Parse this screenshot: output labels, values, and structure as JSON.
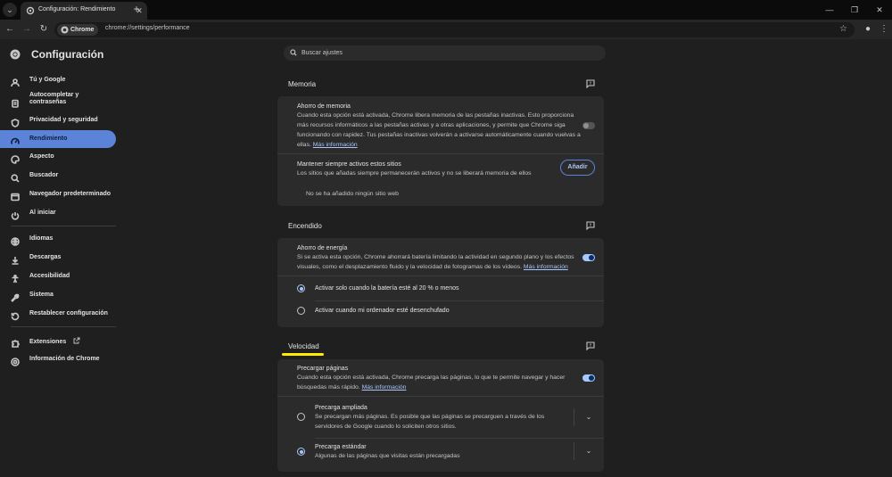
{
  "browser": {
    "tab_title": "Configuración: Rendimiento",
    "site_chip": "Chrome",
    "url": "chrome://settings/performance"
  },
  "sidebar": {
    "title": "Configuración",
    "items": [
      {
        "label": "Tú y Google",
        "icon": "person-icon"
      },
      {
        "label": "Autocompletar y contraseñas",
        "icon": "clipboard-icon"
      },
      {
        "label": "Privacidad y seguridad",
        "icon": "shield-icon"
      },
      {
        "label": "Rendimiento",
        "icon": "speedometer-icon",
        "selected": true
      },
      {
        "label": "Aspecto",
        "icon": "palette-icon"
      },
      {
        "label": "Buscador",
        "icon": "search-icon"
      },
      {
        "label": "Navegador predeterminado",
        "icon": "browser-window-icon"
      },
      {
        "label": "Al iniciar",
        "icon": "power-icon"
      },
      {
        "label": "Idiomas",
        "icon": "globe-icon"
      },
      {
        "label": "Descargas",
        "icon": "download-icon"
      },
      {
        "label": "Accesibilidad",
        "icon": "accessibility-icon"
      },
      {
        "label": "Sistema",
        "icon": "wrench-icon"
      },
      {
        "label": "Restablecer configuración",
        "icon": "reset-icon"
      },
      {
        "label": "Extensiones",
        "icon": "puzzle-icon"
      },
      {
        "label": "Información de Chrome",
        "icon": "chrome-logo-icon"
      }
    ]
  },
  "search": {
    "placeholder": "Buscar ajustes"
  },
  "sections": {
    "memory": {
      "title": "Memoria",
      "saver_title": "Ahorro de memoria",
      "saver_desc": "Cuando esta opción está activada, Chrome libera memoria de las pestañas inactivas. Esto proporciona más recursos informáticos a las pestañas activas y a otras aplicaciones, y permite que Chrome siga funcionando con rapidez. Tus pestañas inactivas volverán a activarse automáticamente cuando vuelvas a ellas.",
      "saver_link": "Más información",
      "saver_on": false,
      "keep_title": "Mantener siempre activos estos sitios",
      "keep_desc": "Los sitios que añadas siempre permanecerán activos y no se liberará memoria de ellos",
      "add_button": "Añadir",
      "empty_text": "No se ha añadido ningún sitio web"
    },
    "power": {
      "title": "Encendido",
      "saver_title": "Ahorro de energía",
      "saver_desc": "Si se activa esta opción, Chrome ahorrará batería limitando la actividad en segundo plano y los efectos visuales, como el desplazamiento fluido y la velocidad de fotogramas de los vídeos.",
      "saver_link": "Más información",
      "saver_on": true,
      "option_1": "Activar solo cuando la batería esté al 20 % o menos",
      "option_2": "Activar cuando mi ordenador esté desenchufado",
      "selected_option": 1
    },
    "speed": {
      "title": "Velocidad",
      "preload_title": "Precargar páginas",
      "preload_desc": "Cuando esta opción está activada, Chrome precarga las páginas, lo que te permite navegar y hacer búsquedas más rápido.",
      "preload_link": "Más información",
      "preload_on": true,
      "extended_title": "Precarga ampliada",
      "extended_desc": "Se precargan más páginas. Es posible que las páginas se precarguen a través de los servidores de Google cuando lo soliciten otros sitios.",
      "standard_title": "Precarga estándar",
      "standard_desc": "Algunas de las páginas que visitas están precargadas",
      "selected_option": 2
    }
  },
  "colors": {
    "accent": "#a8c7fa",
    "selected_nav": "#5b84d8",
    "highlight": "#ffeb00"
  }
}
